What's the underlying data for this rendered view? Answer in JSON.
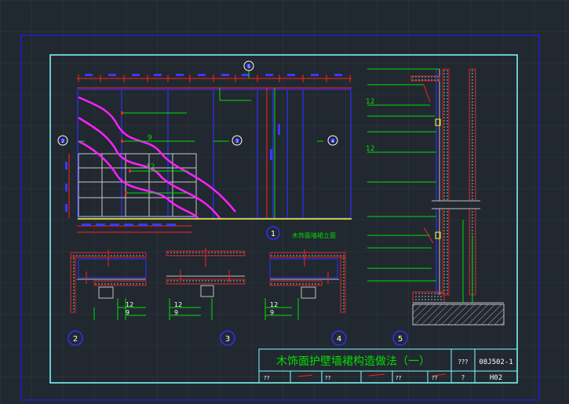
{
  "drawing": {
    "title": "木饰面护壁墙裙构造做法（一）",
    "code_label": "???",
    "atlas_code": "08J502-1",
    "page_label": "?",
    "page_number": "H02",
    "footer_cells": [
      "??",
      "??",
      "??",
      "??"
    ]
  },
  "elevation": {
    "caption": "木饰面墙裙立面",
    "number": "1",
    "callouts": [
      "2",
      "3",
      "4",
      "5"
    ],
    "top_callout": "5",
    "label_9": "9",
    "label_12": "12"
  },
  "details": {
    "numbers": [
      "2",
      "3",
      "4",
      "5"
    ],
    "label_12": "12",
    "label_9": "9"
  },
  "section5": {
    "label_12a": "12",
    "label_12b": "12"
  },
  "colors": {
    "background": "#212830",
    "frame": "#2020c8",
    "border_inner": "#7fffff",
    "annotation": "#00e000",
    "dimension": "#ff2020",
    "curve": "#ff20ff",
    "structure": "#3030ff",
    "hatch": "#c0c0c0",
    "text": "#ffffff"
  }
}
